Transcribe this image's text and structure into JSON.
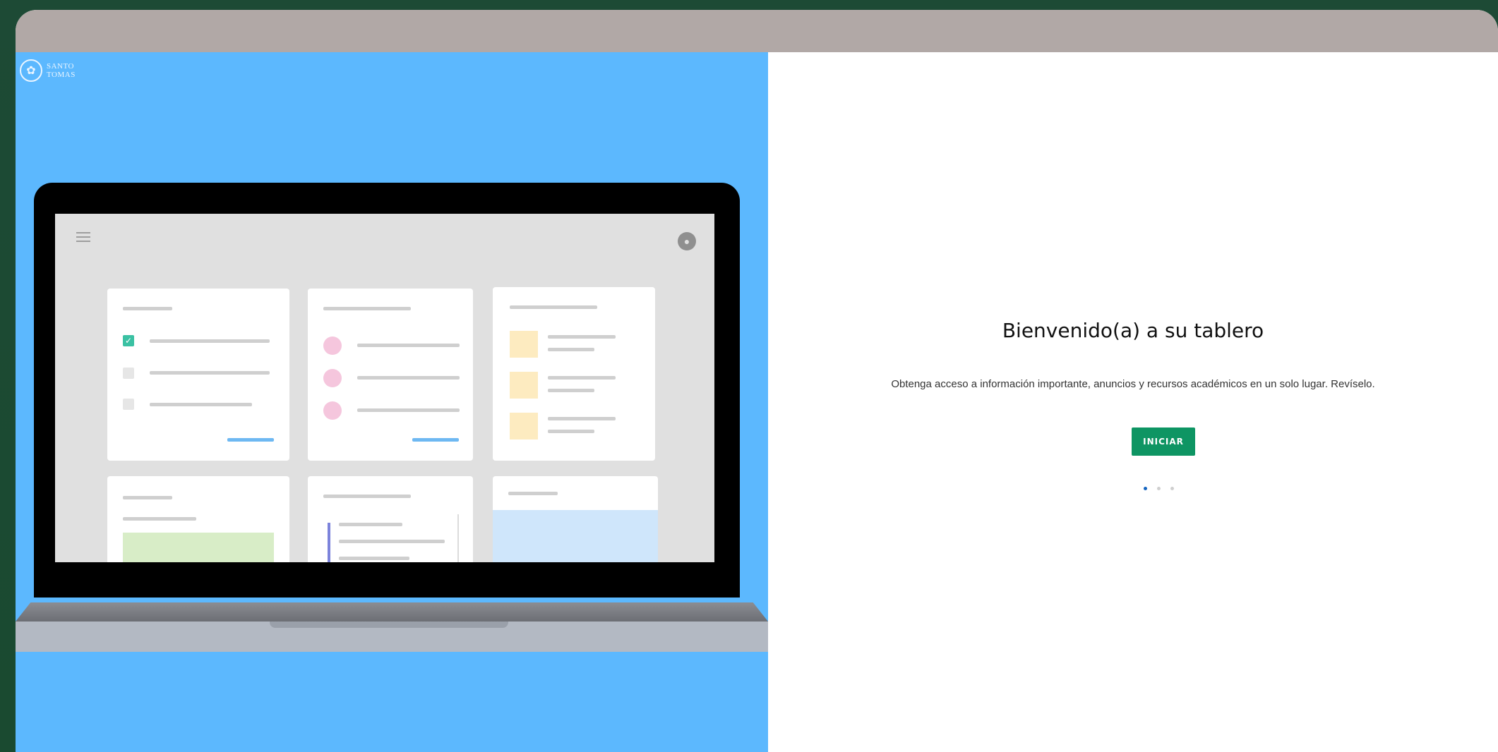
{
  "logo": {
    "line1": "SANTO",
    "line2": "TOMAS"
  },
  "welcome": {
    "title": "Bienvenido(a) a su tablero",
    "description": "Obtenga acceso a información importante, anuncios y recursos académicos en un solo lugar. Revíselo.",
    "start_button": "INICIAR"
  },
  "pager": {
    "total": 3,
    "active_index": 0
  },
  "colors": {
    "background": "#1d4a35",
    "topbar": "#b1a8a6",
    "left_panel": "#5cb8fe",
    "accent_button": "#0e9563",
    "pager_active": "#1565c0"
  },
  "icons": [
    "santo-tomas-logo-icon",
    "menu-icon",
    "avatar-icon"
  ]
}
